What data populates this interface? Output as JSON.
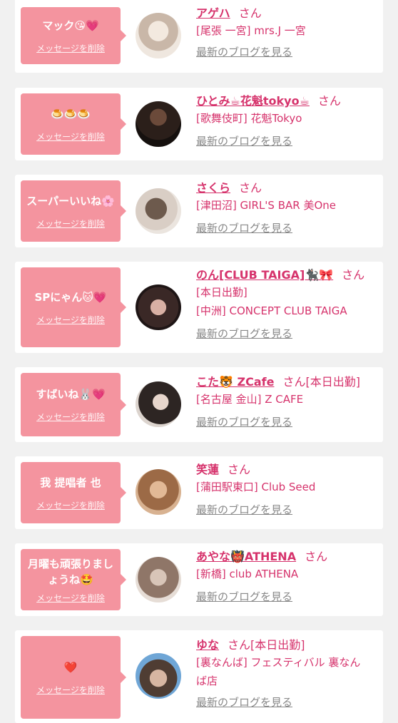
{
  "cards": [
    {
      "message": "マック😘💗",
      "delete_label": "メッセージを削除",
      "name": "アゲハ",
      "san": "さん",
      "extra": "",
      "lines": [
        "[尾張 一宮] mrs.J 一宮"
      ],
      "blog": "最新のブログを見る",
      "avatar_colors": [
        "#efe7df",
        "#cfc3b6"
      ]
    },
    {
      "message": "🍮🍮🍮",
      "delete_label": "メッセージを削除",
      "name": "ひとみ☕花魁tokyo☕",
      "san": "さん",
      "extra": "",
      "lines": [
        "[歌舞伎町] 花魁Tokyo"
      ],
      "blog": "最新のブログを見る",
      "avatar_colors": [
        "#3a2a24",
        "#1c1614"
      ]
    },
    {
      "message": "スーパーいいね🌸",
      "delete_label": "メッセージを削除",
      "name": "さくら",
      "san": "さん",
      "extra": "",
      "lines": [
        "[津田沼] GIRL'S BAR 美One"
      ],
      "blog": "最新のブログを見る",
      "avatar_colors": [
        "#e9e2dc",
        "#7b6a5e"
      ]
    },
    {
      "message": "SPにゃん🐱💗",
      "delete_label": "メッセージを削除",
      "name": "のん[CLUB TAIGA]🐈‍⬛🎀",
      "san": "さん",
      "extra": "",
      "lines": [
        "[本日出勤]",
        "[中洲] CONCEPT CLUB TAIGA"
      ],
      "blog": "最新のブログを見る",
      "avatar_colors": [
        "#3b2a28",
        "#c7a196"
      ]
    },
    {
      "message": "すばいね🐰💗",
      "delete_label": "メッセージを削除",
      "name": "こた🐯 ZCafe",
      "san": "さん",
      "extra": "[本日出勤]",
      "lines": [
        "[名古屋 金山] Z CAFE"
      ],
      "blog": "最新のブログを見る",
      "avatar_colors": [
        "#dfd8d2",
        "#2a2422"
      ]
    },
    {
      "message": "我 提唱者 也",
      "delete_label": "メッセージを削除",
      "name": "笑蓮",
      "san": "さん",
      "extra": "",
      "lines": [
        "[蒲田駅東口] Club Seed"
      ],
      "blog": "最新のブログを見る",
      "avatar_colors": [
        "#d9b390",
        "#a8764e"
      ]
    },
    {
      "message": "月曜も頑張りましょうね🤩",
      "delete_label": "メッセージを削除",
      "name": "あやな👹ATHENA",
      "san": "さん",
      "extra": "",
      "lines": [
        "[新橋] club ATHENA"
      ],
      "blog": "最新のブログを見る",
      "avatar_colors": [
        "#e6ddd6",
        "#9c8578"
      ]
    },
    {
      "message": "❤️",
      "delete_label": "メッセージを削除",
      "name": "ゆな",
      "san": "さん",
      "extra": "[本日出勤]",
      "lines": [
        "[裏なんば] フェスティバル 裏なんば店"
      ],
      "blog": "最新のブログを見る",
      "avatar_colors": [
        "#5a4438",
        "#d8b9a6"
      ]
    }
  ]
}
